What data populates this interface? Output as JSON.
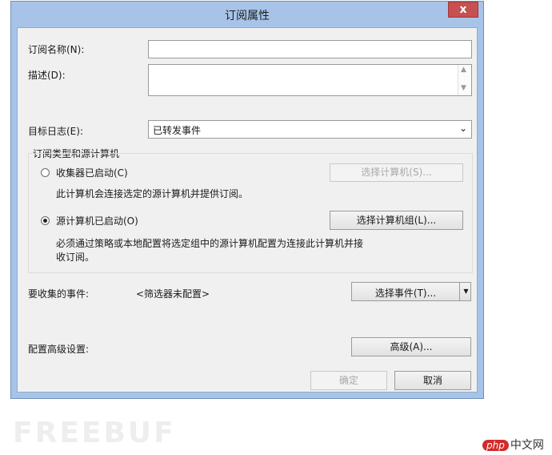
{
  "window": {
    "title": "订阅属性",
    "close_glyph": "x"
  },
  "fields": {
    "name_label": "订阅名称(N):",
    "name_value": "",
    "desc_label": "描述(D):",
    "desc_value": "",
    "target_log_label": "目标日志(E):",
    "target_log_value": "已转发事件"
  },
  "subscription_type": {
    "group_label": "订阅类型和源计算机",
    "collector": {
      "label": "收集器已启动(C)",
      "checked": false,
      "button": "选择计算机(S)...",
      "description": "此计算机会连接选定的源计算机并提供订阅。"
    },
    "source": {
      "label": "源计算机已启动(O)",
      "checked": true,
      "button": "选择计算机组(L)...",
      "description_line1": "必须通过策略或本地配置将选定组中的源计算机配置为连接此计算机并接",
      "description_line2": "收订阅。"
    }
  },
  "events": {
    "label": "要收集的事件:",
    "status": "<筛选器未配置>",
    "button": "选择事件(T)..."
  },
  "advanced": {
    "label": "配置高级设置:",
    "button": "高级(A)..."
  },
  "footer": {
    "ok": "确定",
    "cancel": "取消"
  },
  "watermark": {
    "text": "FREEBUF",
    "site_badge": "php",
    "site_text": "中文网"
  },
  "colors": {
    "title_bar": "#a7c4e8",
    "close_button": "#c75050",
    "dialog_bg": "#f0f0f0"
  }
}
